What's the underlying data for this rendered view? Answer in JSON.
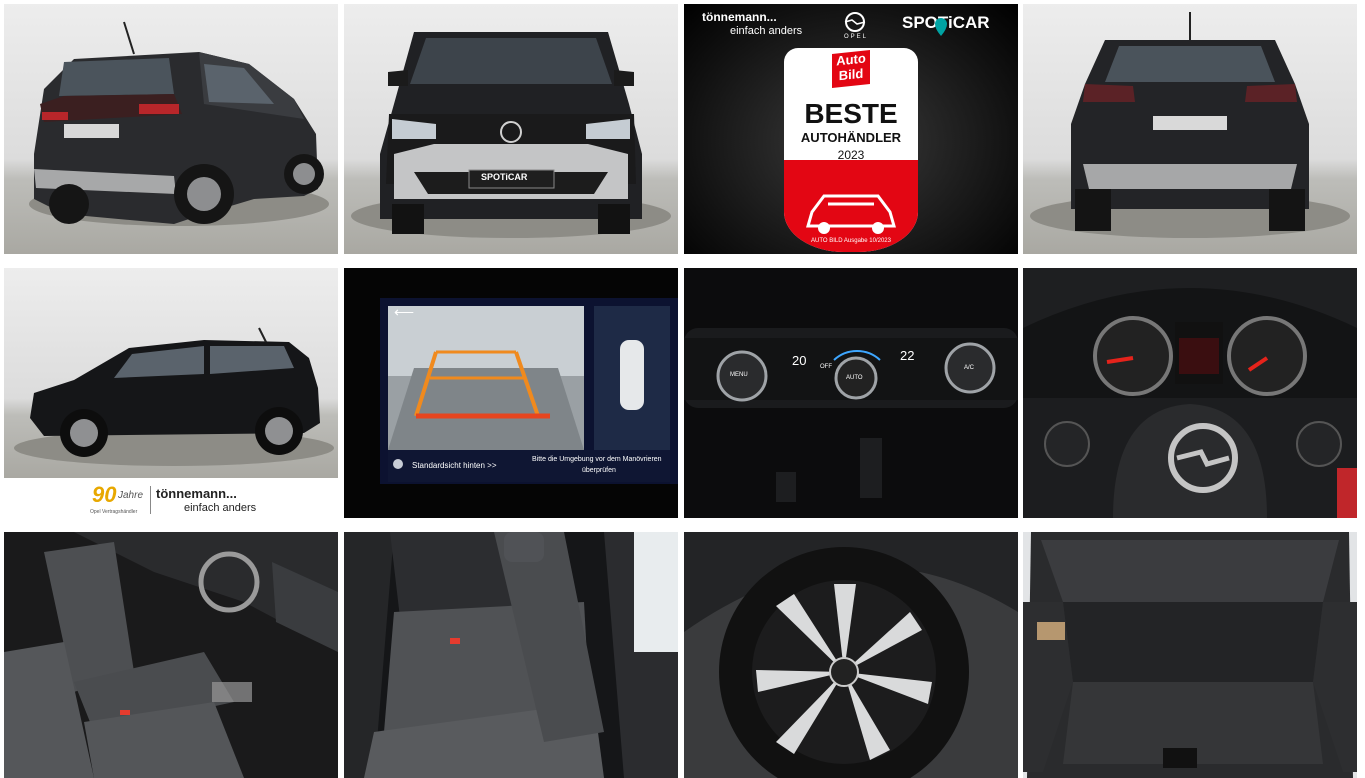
{
  "gallery": {
    "tiles": [
      {
        "alt": "Rear three-quarter view"
      },
      {
        "alt": "Front view"
      },
      {
        "alt": "Award"
      },
      {
        "alt": "Rear view"
      },
      {
        "alt": "Side view"
      },
      {
        "alt": "Rear camera display"
      },
      {
        "alt": "Climate control"
      },
      {
        "alt": "Instrument cluster and steering wheel"
      },
      {
        "alt": "Front seats"
      },
      {
        "alt": "Rear seats"
      },
      {
        "alt": "Wheel"
      },
      {
        "alt": "Trunk"
      }
    ]
  },
  "dealer": {
    "name": "tönnemann...",
    "tagline": "einfach anders",
    "brand": "OPEL",
    "program": "SPOTiCAR",
    "plate": "SPOTiCAR",
    "anniversary_number": "90",
    "anniversary_word": "Jahre",
    "anniversary_sub": "Opel Vertragshändler"
  },
  "award": {
    "logo_line1": "Auto",
    "logo_line2": "Bild",
    "title": "BESTE",
    "subtitle": "AUTOHÄNDLER",
    "year": "2023",
    "source": "AUTO BILD Ausgabe 10/2023"
  },
  "camera_screen": {
    "view_label": "Standardsicht hinten >>",
    "warning_line1": "Bitte die Umgebung vor dem Manövrieren",
    "warning_line2": "überprüfen",
    "back_arrow": "⟵"
  },
  "climate": {
    "left_temp": "20",
    "right_temp": "22",
    "off_label": "OFF",
    "menu_label": "MENU",
    "auto_label": "AUTO",
    "ac_label": "A/C"
  },
  "colors": {
    "opel_red": "#e30613",
    "spoticar_teal": "#00a3a3",
    "camera_orange": "#f08a1e",
    "camera_red": "#e6451f"
  }
}
